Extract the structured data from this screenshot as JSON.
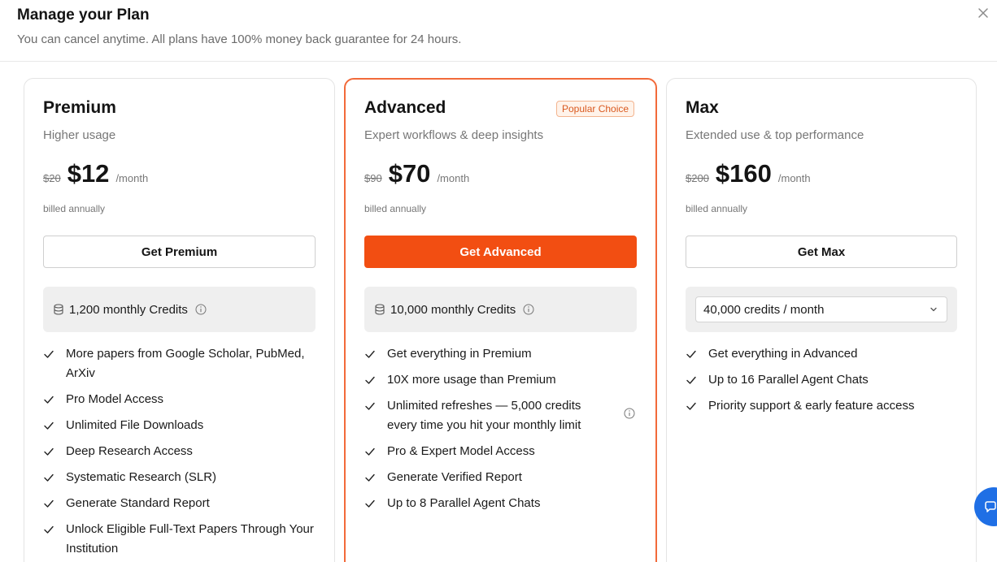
{
  "header": {
    "title": "Manage your Plan",
    "subtitle": "You can cancel anytime. All plans have 100% money back guarantee for 24 hours."
  },
  "plans": [
    {
      "name": "Premium",
      "description": "Higher usage",
      "old_price": "$20",
      "price": "$12",
      "period": "/month",
      "billed": "billed annually",
      "cta": "Get Premium",
      "credits": "1,200 monthly Credits",
      "features": [
        "More papers from Google Scholar, PubMed, ArXiv",
        "Pro Model Access",
        "Unlimited File Downloads",
        "Deep Research Access",
        "Systematic Research (SLR)",
        "Generate Standard Report",
        "Unlock Eligible Full-Text Papers Through Your Institution"
      ]
    },
    {
      "name": "Advanced",
      "badge": "Popular Choice",
      "description": "Expert workflows & deep insights",
      "old_price": "$90",
      "price": "$70",
      "period": "/month",
      "billed": "billed annually",
      "cta": "Get Advanced",
      "credits": "10,000 monthly Credits",
      "features": [
        "Get everything in Premium",
        "10X more usage than Premium",
        "Unlimited refreshes — 5,000 credits every time you hit your monthly limit",
        "Pro & Expert Model Access",
        "Generate Verified Report",
        "Up to 8 Parallel Agent Chats"
      ]
    },
    {
      "name": "Max",
      "description": "Extended use & top performance",
      "old_price": "$200",
      "price": "$160",
      "period": "/month",
      "billed": "billed annually",
      "cta": "Get Max",
      "credits_select": "40,000 credits / month",
      "features": [
        "Get everything in Advanced",
        "Up to 16 Parallel Agent Chats",
        "Priority support & early feature access"
      ]
    }
  ],
  "colors": {
    "accent": "#f24e12",
    "accent_border": "#f26a3a",
    "chat_button": "#1f6fe5"
  },
  "icons": {
    "close": "close-icon",
    "check": "check-icon",
    "database": "database-icon",
    "info": "info-icon",
    "dropdown": "chevron-down-icon",
    "chat": "chat-icon"
  }
}
